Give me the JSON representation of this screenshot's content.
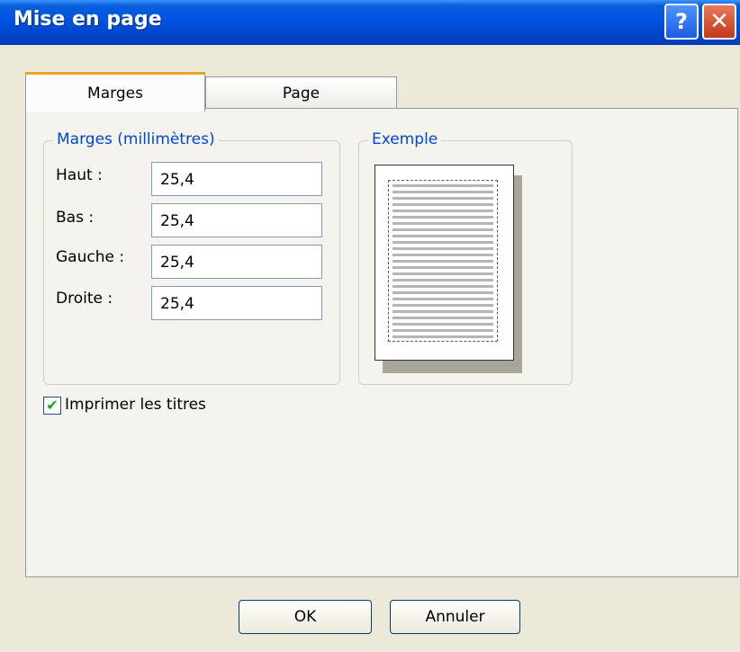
{
  "window": {
    "title": "Mise en page"
  },
  "titlebar_buttons": {
    "help_glyph": "?",
    "close_glyph": "✕"
  },
  "tabs": [
    {
      "label": "Marges",
      "active": true
    },
    {
      "label": "Page",
      "active": false
    }
  ],
  "margins_group": {
    "legend": "Marges (millimètres)",
    "fields": [
      {
        "label": "Haut :",
        "value": "25,4"
      },
      {
        "label": "Bas :",
        "value": "25,4"
      },
      {
        "label": "Gauche :",
        "value": "25,4"
      },
      {
        "label": "Droite :",
        "value": "25,4"
      }
    ]
  },
  "example_group": {
    "legend": "Exemple"
  },
  "print_titles": {
    "label": "Imprimer les titres",
    "checked": true,
    "check_glyph": "✔"
  },
  "buttons": {
    "ok": "OK",
    "cancel": "Annuler"
  },
  "colors": {
    "title_bar": "#0055e5",
    "legend_text": "#0046d5",
    "dialog_bg": "#ece9d8",
    "tab_highlight": "#f0a020"
  }
}
